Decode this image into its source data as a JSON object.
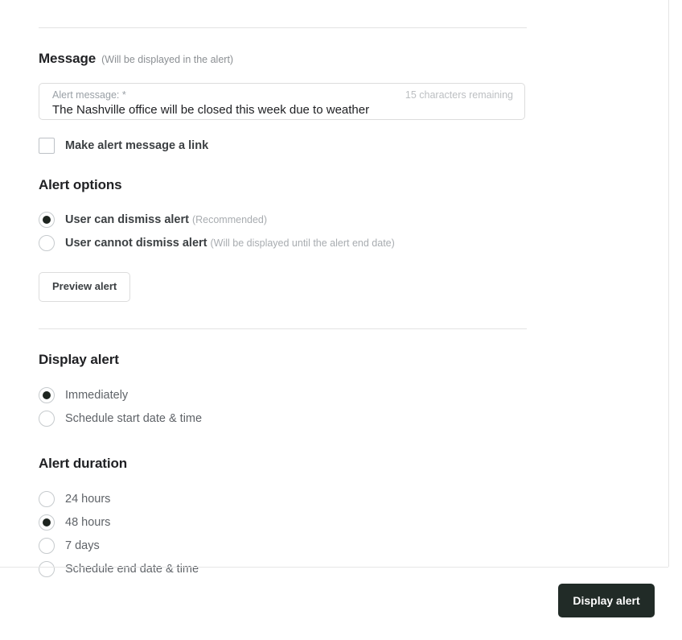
{
  "message_section": {
    "heading": "Message",
    "heading_note": "(Will be displayed in the alert)",
    "field": {
      "label": "Alert message: *",
      "value": "The Nashville office will be closed this week due to weather",
      "placeholder": "Alert message",
      "counter": "15 characters remaining"
    },
    "link_checkbox": {
      "label": "Make alert message a link",
      "checked": false
    }
  },
  "alert_options": {
    "heading": "Alert options",
    "options": [
      {
        "label": "User can dismiss alert",
        "note": "(Recommended)",
        "selected": true
      },
      {
        "label": "User cannot dismiss alert",
        "note": "(Will be displayed until the alert end date)",
        "selected": false
      }
    ],
    "preview_button": "Preview alert"
  },
  "display_alert": {
    "heading": "Display alert",
    "options": [
      {
        "label": "Immediately",
        "selected": true
      },
      {
        "label": "Schedule start date & time",
        "selected": false
      }
    ]
  },
  "alert_duration": {
    "heading": "Alert duration",
    "options": [
      {
        "label": "24 hours",
        "selected": false
      },
      {
        "label": "48 hours",
        "selected": true
      },
      {
        "label": "7 days",
        "selected": false
      },
      {
        "label": "Schedule end date & time",
        "selected": false
      }
    ]
  },
  "footer": {
    "submit_label": "Display alert",
    "submit_color": "#212b27"
  }
}
